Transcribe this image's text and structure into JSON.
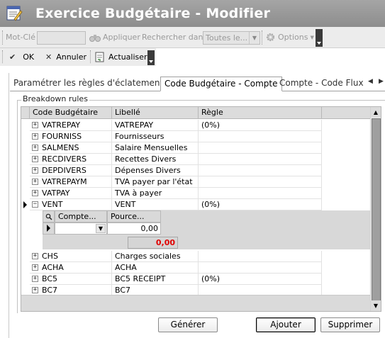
{
  "window": {
    "title": "Exercice Budgétaire - Modifier"
  },
  "search_toolbar": {
    "keyword_label": "Mot-Clé",
    "keyword_value": "",
    "apply_label": "Appliquer",
    "search_in_label": "Rechercher dans",
    "search_in_value": "Toutes le...",
    "options_label": "Options"
  },
  "action_toolbar": {
    "ok_label": "OK",
    "cancel_label": "Annuler",
    "refresh_label": "Actualiser"
  },
  "tabs": [
    {
      "label": "Paramétrer les règles d'éclatement"
    },
    {
      "label": "Code Budgétaire - Compte"
    },
    {
      "label": "Compte - Code Flux"
    }
  ],
  "group": {
    "label": "Breakdown rules"
  },
  "grid": {
    "columns": [
      "Code Budgétaire",
      "Libellé",
      "Règle"
    ],
    "rows_top": [
      {
        "code": "VATREPAY",
        "libelle": "VATREPAY",
        "regle": "(0%)"
      },
      {
        "code": "FOURNISS",
        "libelle": "Fournisseurs",
        "regle": ""
      },
      {
        "code": "SALMENS",
        "libelle": "Salaire Mensuelles",
        "regle": ""
      },
      {
        "code": "RECDIVERS",
        "libelle": "Recettes Divers",
        "regle": ""
      },
      {
        "code": "DEPDIVERS",
        "libelle": "Dépenses Divers",
        "regle": ""
      },
      {
        "code": "VATREPAYM",
        "libelle": "TVA payer par l'état",
        "regle": ""
      },
      {
        "code": "VATPAY",
        "libelle": "TVA à payer",
        "regle": ""
      },
      {
        "code": "VENT",
        "libelle": "VENT",
        "regle": "(0%)"
      }
    ],
    "detail": {
      "columns": [
        "Compte...",
        "Pource..."
      ],
      "row": {
        "compte": "",
        "pourcentage": "0,00"
      },
      "total": "0,00"
    },
    "rows_bottom": [
      {
        "code": "CHS",
        "libelle": "Charges sociales",
        "regle": ""
      },
      {
        "code": "ACHA",
        "libelle": "ACHA",
        "regle": ""
      },
      {
        "code": "BC5",
        "libelle": "BC5 RECEIPT",
        "regle": "(0%)"
      },
      {
        "code": "BC7",
        "libelle": "BC7",
        "regle": ""
      }
    ]
  },
  "buttons": {
    "generate": "Générer",
    "add": "Ajouter",
    "delete": "Supprimer"
  },
  "symbols": {
    "expand": "+",
    "collapse": "−",
    "dropdown": "▼",
    "scroll_up": "▲",
    "scroll_down": "▼",
    "tab_prev": "◀",
    "tab_next": "▶",
    "ok_check": "✔",
    "cancel_x": "✕"
  },
  "colors": {
    "title_bar": "#9a9a9a",
    "total_text": "#e00000",
    "toolbar_bg": "#ececec"
  }
}
